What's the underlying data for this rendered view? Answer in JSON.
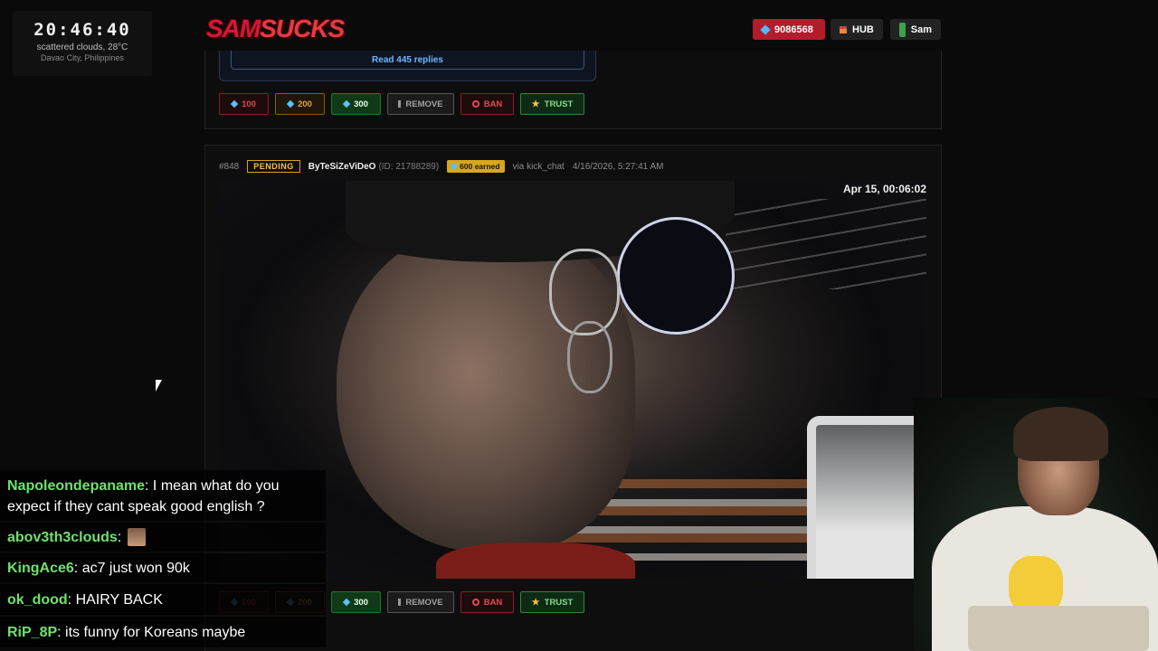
{
  "overlay": {
    "clock": {
      "time": "20:46:40",
      "weather": "scattered clouds, 28°C",
      "location": "Davao City, Philippines"
    }
  },
  "header": {
    "logo_text_a": "SAM",
    "logo_text_b": "SUCKS",
    "balance": "9086568",
    "hub_label": "HUB",
    "user_label": "Sam"
  },
  "prev_card": {
    "replies_label": "Read 445 replies",
    "actions": {
      "gem100": "100",
      "gem200": "200",
      "gem300": "300",
      "remove": "REMOVE",
      "ban": "BAN",
      "trust": "TRUST"
    }
  },
  "card": {
    "id": "#848",
    "status": "PENDING",
    "username": "ByTeSiZeViDeO",
    "user_id": "(ID: 21788289)",
    "earned": "600 earned",
    "source": "via kick_chat",
    "datetime": "4/16/2026, 5:27:41 AM",
    "video_timestamp": "Apr 15, 00:06:02",
    "actions": {
      "gem100": "100",
      "gem200": "200",
      "gem300": "300",
      "remove": "REMOVE",
      "ban": "BAN",
      "trust": "TRUST"
    }
  },
  "chat": [
    {
      "user": "Napoleondepaname",
      "text": "I mean what do you expect if they cant speak good english ?"
    },
    {
      "user": "abov3th3clouds",
      "text": ""
    },
    {
      "user": "KingAce6",
      "text": "ac7 just won 90k"
    },
    {
      "user": "ok_dood",
      "text": "HAIRY BACK"
    },
    {
      "user": "RiP_8P",
      "text": "its funny for Koreans maybe"
    }
  ],
  "colors": {
    "accent_red": "#b31c2b",
    "pending_gold": "#d6a31e",
    "chat_user_green": "#6fe26c",
    "link_blue": "#6fb6ff"
  }
}
